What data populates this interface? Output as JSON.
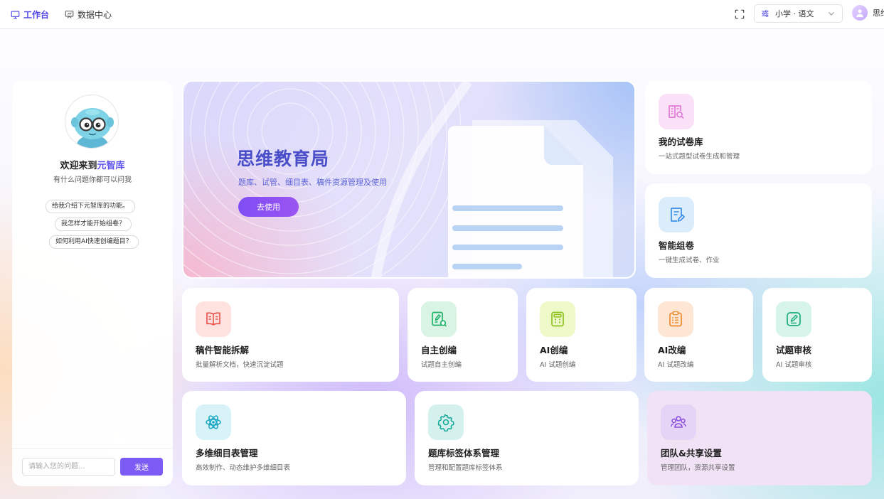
{
  "topbar": {
    "tabs": [
      {
        "label": "工作台",
        "active": true
      },
      {
        "label": "数据中心",
        "active": false
      }
    ],
    "grade_selector": {
      "value": "小学 · 语文"
    },
    "user": {
      "name": "思维"
    }
  },
  "chat": {
    "welcome_prefix": "欢迎来到",
    "welcome_brand": "元智库",
    "subtitle": "有什么问题你都可以问我",
    "suggestions": [
      "给我介绍下元智库的功能。",
      "我怎样才能开始组卷？",
      "如何利用AI快速创编题目？"
    ],
    "input_placeholder": "请输入您的问题...",
    "send_label": "发送"
  },
  "banner": {
    "title": "思维教育局",
    "subtitle": "题库、试管、细目表、稿件资源管理及使用",
    "button_label": "去使用"
  },
  "features": {
    "paper_library": {
      "title": "我的试卷库",
      "desc": "一站式题型试卷生成和管理",
      "icon": "book-search-icon",
      "color": "#e07ad6"
    },
    "smart_compose": {
      "title": "智能组卷",
      "desc": "一键生成试卷、作业",
      "icon": "document-edit-icon",
      "color": "#3b8fe6"
    },
    "manuscript_split": {
      "title": "稿件智能拆解",
      "desc": "批量解析文档，快速沉淀试题",
      "icon": "open-book-icon",
      "color": "#e8564f"
    },
    "self_create": {
      "title": "自主创编",
      "desc": "试题自主创编",
      "icon": "pen-search-icon",
      "color": "#23b26b"
    },
    "ai_create": {
      "title": "AI创编",
      "desc": "AI 试题创编",
      "icon": "calculator-icon",
      "color": "#8cc21e"
    },
    "ai_adapt": {
      "title": "AI改编",
      "desc": "AI 试题改编",
      "icon": "clipboard-list-icon",
      "color": "#ef8a2f"
    },
    "review": {
      "title": "试题审核",
      "desc": "AI 试题审核",
      "icon": "edit-square-icon",
      "color": "#1eab7c"
    },
    "blueprint": {
      "title": "多维细目表管理",
      "desc": "高效制作、动态维护多维细目表",
      "icon": "atom-icon",
      "color": "#17a6c4"
    },
    "tag_system": {
      "title": "题库标签体系管理",
      "desc": "管理和配置题库标签体系",
      "icon": "gear-icon",
      "color": "#14a89a"
    },
    "team_share": {
      "title": "团队&共享设置",
      "desc": "管理团队，资源共享设置",
      "icon": "team-icon",
      "color": "#8a4fe0"
    }
  }
}
